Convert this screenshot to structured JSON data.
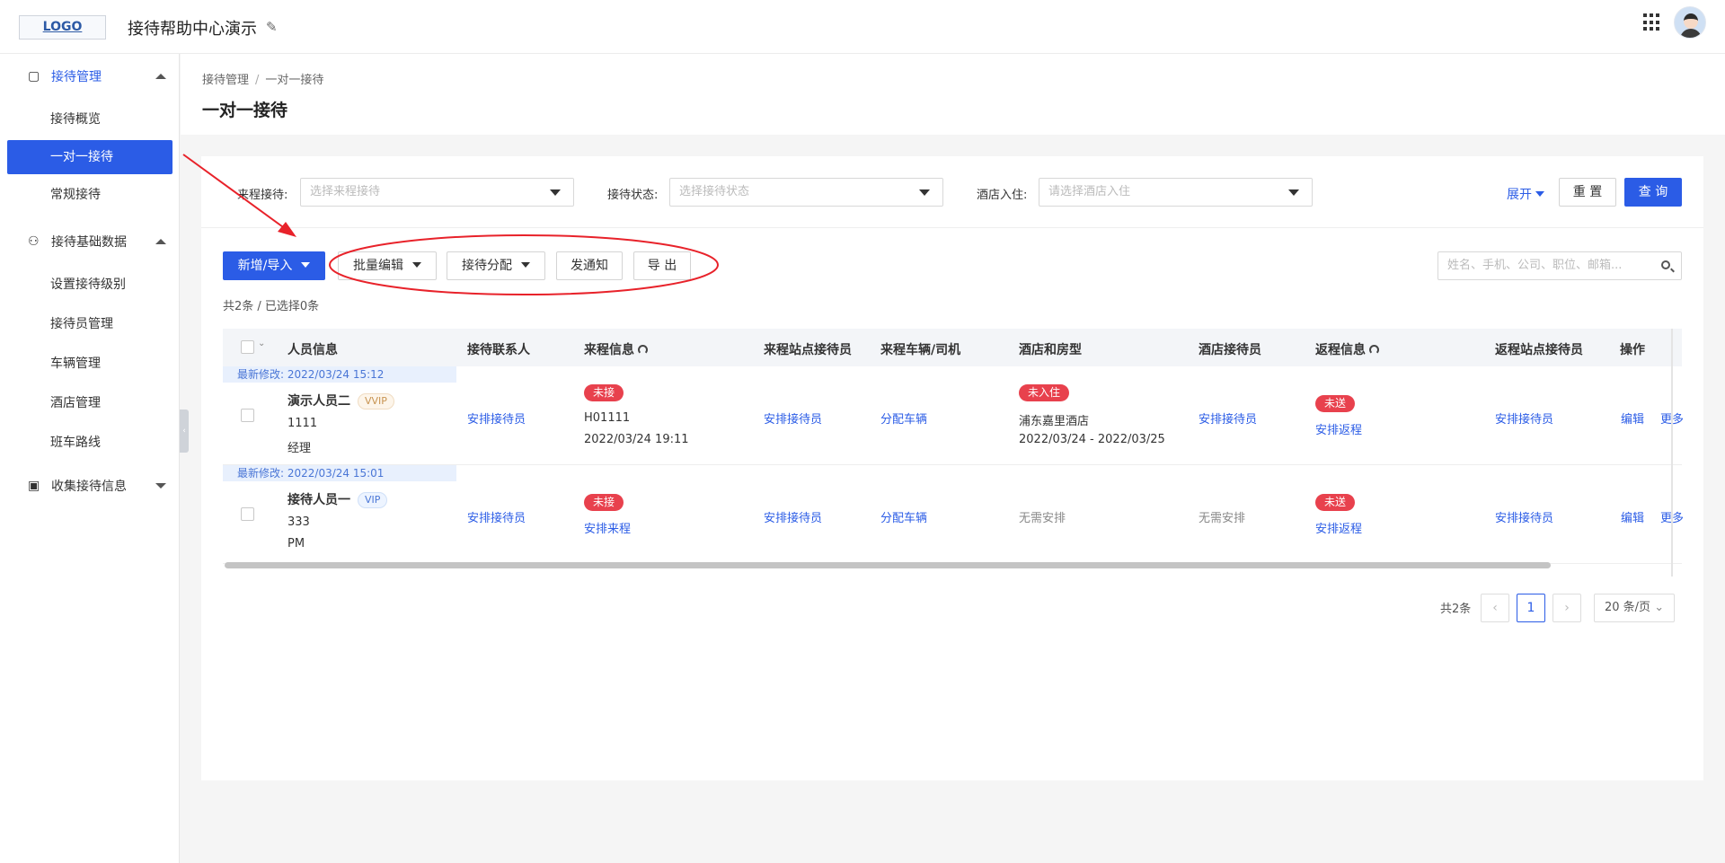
{
  "header": {
    "logo": "LOGO",
    "title": "接待帮助中心演示"
  },
  "sidebar": {
    "groups": [
      {
        "label": "接待管理",
        "icon": "suitcase-icon",
        "expanded": true
      },
      {
        "label": "接待基础数据",
        "icon": "people-icon",
        "expanded": true
      },
      {
        "label": "收集接待信息",
        "icon": "calendar-icon",
        "expanded": false
      }
    ],
    "items": [
      "接待概览",
      "一对一接待",
      "常规接待",
      "设置接待级别",
      "接待员管理",
      "车辆管理",
      "酒店管理",
      "班车路线"
    ],
    "active_item": "一对一接待",
    "collapse_glyph": "‹"
  },
  "page": {
    "breadcrumb": [
      "接待管理",
      "一对一接待"
    ],
    "breadcrumb_sep": "/",
    "title": "一对一接待"
  },
  "filters": [
    {
      "label": "来程接待:",
      "placeholder": "选择来程接待"
    },
    {
      "label": "接待状态:",
      "placeholder": "选择接待状态"
    },
    {
      "label": "酒店入住:",
      "placeholder": "请选择酒店入住"
    }
  ],
  "filter_actions": {
    "expand": "展开",
    "reset": "重 置",
    "query": "查 询"
  },
  "toolbar": {
    "add_import": "新增/导入",
    "batch_edit": "批量编辑",
    "assign": "接待分配",
    "notify": "发通知",
    "export": "导 出"
  },
  "search": {
    "placeholder": "姓名、手机、公司、职位、邮箱..."
  },
  "selection_summary": "共2条 / 已选择0条",
  "table": {
    "columns": [
      "人员信息",
      "接待联系人",
      "来程信息",
      "来程站点接待员",
      "来程车辆/司机",
      "酒店和房型",
      "酒店接待员",
      "返程信息",
      "返程站点接待员",
      "操作"
    ],
    "rows": [
      {
        "modified": "最新修改:  2022/03/24 15:12",
        "name": "演示人员二",
        "level": "VVIP",
        "phone": "1111",
        "position": "经理",
        "contact": "安排接待员",
        "arrival_status": "未接",
        "arrival_line1": "H01111",
        "arrival_line2": "2022/03/24 19:11",
        "arrival_station": "安排接待员",
        "vehicle": "分配车辆",
        "hotel_status": "未入住",
        "hotel_name": "浦东嘉里酒店",
        "hotel_dates": "2022/03/24 - 2022/03/25",
        "hotel_staff": "安排接待员",
        "return_status": "未送",
        "return_action": "安排返程",
        "return_station": "安排接待员",
        "edit": "编辑",
        "more": "更多"
      },
      {
        "modified": "最新修改:  2022/03/24 15:01",
        "name": "接待人员一",
        "level": "VIP",
        "phone": "333",
        "position": "PM",
        "contact": "安排接待员",
        "arrival_status": "未接",
        "arrival_action": "安排来程",
        "arrival_station": "安排接待员",
        "vehicle": "分配车辆",
        "hotel_none": "无需安排",
        "hotel_staff_none": "无需安排",
        "return_status": "未送",
        "return_action": "安排返程",
        "return_station": "安排接待员",
        "edit": "编辑",
        "more": "更多"
      }
    ]
  },
  "pagination": {
    "total": "共2条",
    "prev": "‹",
    "current": "1",
    "next": "›",
    "page_size": "20 条/页"
  },
  "colors": {
    "primary": "#2b5ce6",
    "danger": "#e8414d",
    "annotation": "#e8222a"
  }
}
